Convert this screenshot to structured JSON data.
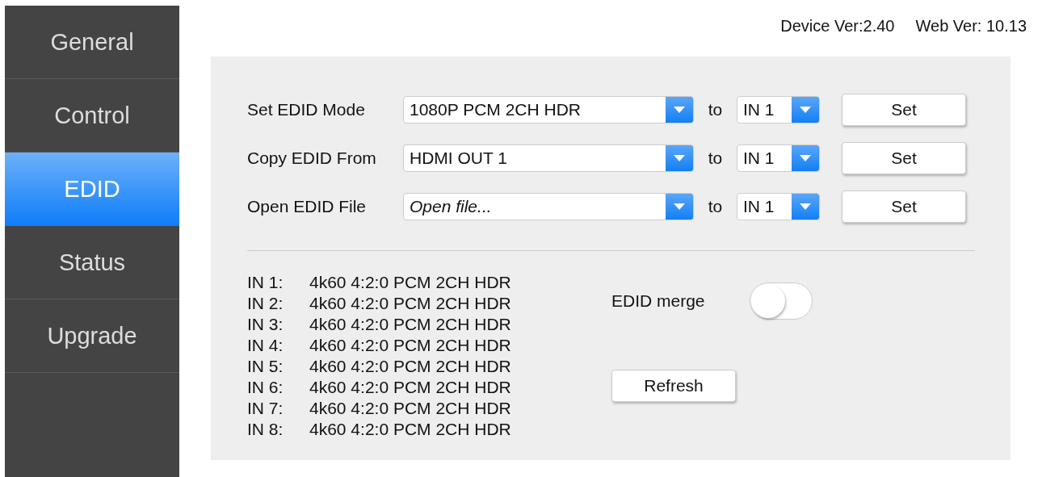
{
  "sidebar": {
    "items": [
      {
        "label": "General",
        "selected": false
      },
      {
        "label": "Control",
        "selected": false
      },
      {
        "label": "EDID",
        "selected": true
      },
      {
        "label": "Status",
        "selected": false
      },
      {
        "label": "Upgrade",
        "selected": false
      }
    ]
  },
  "versions": [
    "Device Ver:2.40",
    "Web Ver: 10.13"
  ],
  "edid_rows": [
    {
      "label": "Set EDID Mode",
      "source": {
        "value": "1080P PCM 2CH HDR"
      },
      "to": "to",
      "target": "IN 1",
      "button": "Set"
    },
    {
      "label": "Copy EDID From",
      "source": {
        "value": "HDMI OUT 1"
      },
      "to": "to",
      "target": "IN 1",
      "button": "Set"
    },
    {
      "label": "Open EDID File",
      "source": {
        "placeholder": "Open file..."
      },
      "to": "to",
      "target": "IN 1",
      "button": "Set"
    }
  ],
  "inputs": [
    {
      "label": "IN 1:",
      "value": "4k60 4:2:0 PCM 2CH HDR"
    },
    {
      "label": "IN 2:",
      "value": "4k60 4:2:0 PCM 2CH HDR"
    },
    {
      "label": "IN 3:",
      "value": "4k60 4:2:0 PCM 2CH HDR"
    },
    {
      "label": "IN 4:",
      "value": "4k60 4:2:0 PCM 2CH HDR"
    },
    {
      "label": "IN 5:",
      "value": "4k60 4:2:0 PCM 2CH HDR"
    },
    {
      "label": "IN 6:",
      "value": "4k60 4:2:0 PCM 2CH HDR"
    },
    {
      "label": "IN 7:",
      "value": "4k60 4:2:0 PCM 2CH HDR"
    },
    {
      "label": "IN 8:",
      "value": "4k60 4:2:0 PCM 2CH HDR"
    }
  ],
  "edid_merge": {
    "label": "EDID merge",
    "on": false
  },
  "refresh_button": "Refresh"
}
